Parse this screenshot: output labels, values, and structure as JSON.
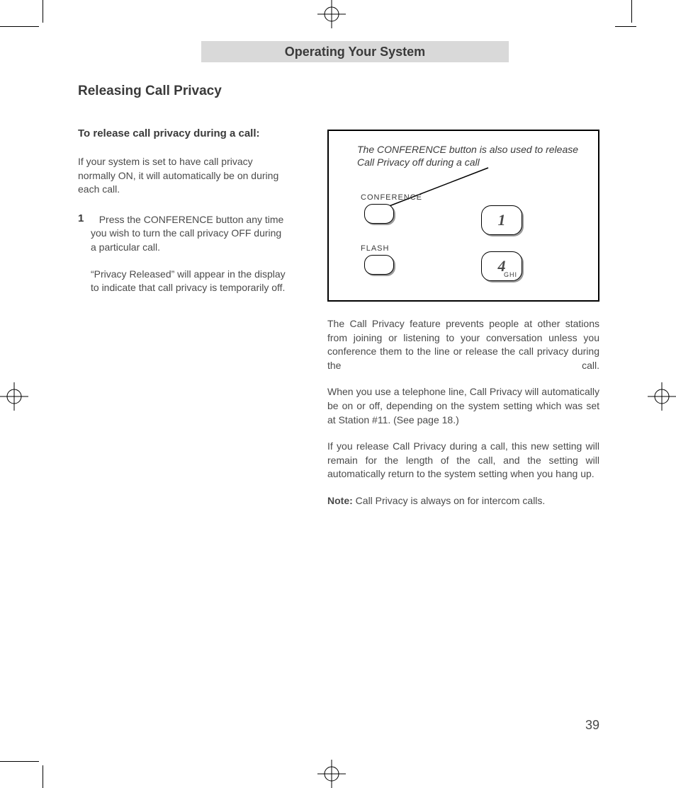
{
  "header": {
    "section_title": "Operating Your System"
  },
  "title": "Releasing Call Privacy",
  "left": {
    "subhead": "To release call privacy during a call:",
    "intro": "If your system is set to have call privacy normally ON, it will automatically be on during each call.",
    "step_num": "1",
    "step_text": "Press the CONFERENCE button any time you wish to turn the call privacy OFF during a particular call.",
    "step_more": "“Privacy Released” will appear in the display to indicate that call privacy is temporarily off."
  },
  "diagram": {
    "caption": "The CONFERENCE button is also used to release Call Privacy off during a call",
    "label_conference": "CONFERENCE",
    "label_flash": "FLASH",
    "key1": "1",
    "key4": "4",
    "key4_sub": "GHI"
  },
  "right": {
    "p1": "The Call Privacy feature prevents people at other stations from joining or listening to your conversation unless you conference them to the line or release the call privacy during the call.",
    "p2": "When you use a telephone line, Call Privacy will automatically be on or off, depending on the system setting which was set at Station #11.  (See page 18.)",
    "p3": "If you release Call Privacy during a call, this new setting will remain for the length of the call, and the setting will automatically return to the system setting when you hang up.",
    "note_label": "Note:",
    "note_text": " Call Privacy is always on for intercom calls."
  },
  "page_number": "39"
}
